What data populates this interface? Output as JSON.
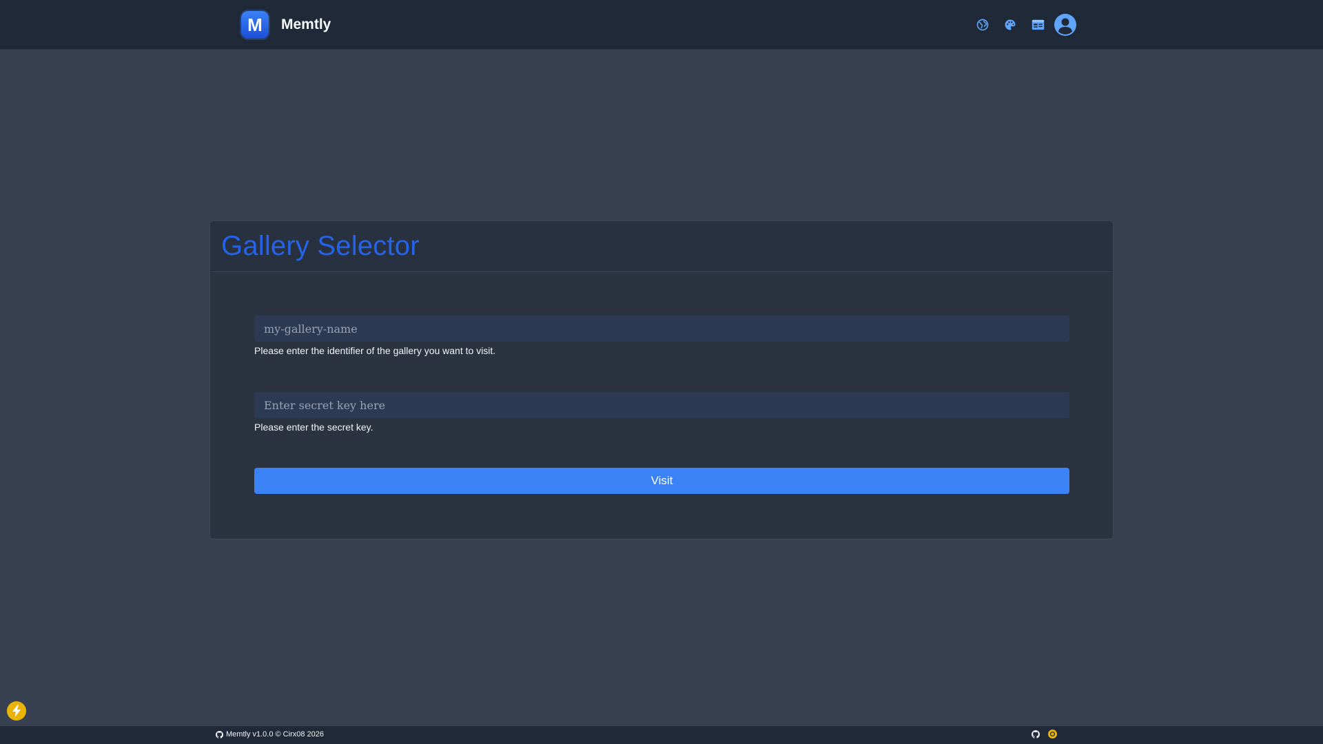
{
  "header": {
    "brand_name": "Memtly",
    "logo_letter": "M",
    "icons": [
      "globe-icon",
      "palette-icon",
      "id-card-icon",
      "user-circle-icon"
    ]
  },
  "card": {
    "title": "Gallery Selector",
    "gallery_input": {
      "placeholder": "my-gallery-name",
      "value": "",
      "help": "Please enter the identifier of the gallery you want to visit."
    },
    "secret_input": {
      "placeholder": "Enter secret key here",
      "value": "",
      "help": "Please enter the secret key."
    },
    "visit_label": "Visit"
  },
  "footer": {
    "text": "Memtly v1.0.0 © Cirx08 2026"
  },
  "colors": {
    "background": "#374151",
    "header_bg": "#1f2937",
    "accent": "#3b82f6",
    "title": "#2563eb",
    "coin": "#eab308"
  }
}
